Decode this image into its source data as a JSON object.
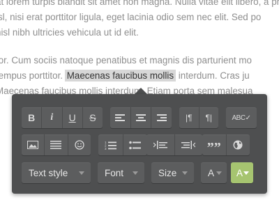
{
  "document": {
    "line1": "at lorem turpis blandit sit amet non magna. Nulla vitae elit libero, a phar",
    "line2": "isl, nisi erat porttitor ligula, eget lacinia odio sem nec elit. Sed po",
    "line3": "nisl nibh ultricies vehicula ut id elit.",
    "line4": "tor. Cum sociis natoque penatibus et magnis dis parturient mo",
    "line5_before": "tempus porttitor. ",
    "line5_selected": "Maecenas faucibus mollis",
    "line5_after": " interdum. Cras ju",
    "line6": "Maecenas faucibus mollis interdum. Etiam porta sem malesua"
  },
  "toolbar": {
    "bold": "B",
    "italic": "i",
    "underline": "U",
    "strike": "S",
    "quote": "””",
    "spellcheck": "ABC",
    "text_style": "Text style",
    "font": "Font",
    "size": "Size",
    "font_color": "A",
    "highlight_color": "A"
  },
  "colors": {
    "panel": "#4e4f50",
    "button": "#5c5d5e",
    "icon": "#d9d9d9",
    "highlight_swatch": "#a6c470",
    "selection": "#d7d7d7"
  }
}
